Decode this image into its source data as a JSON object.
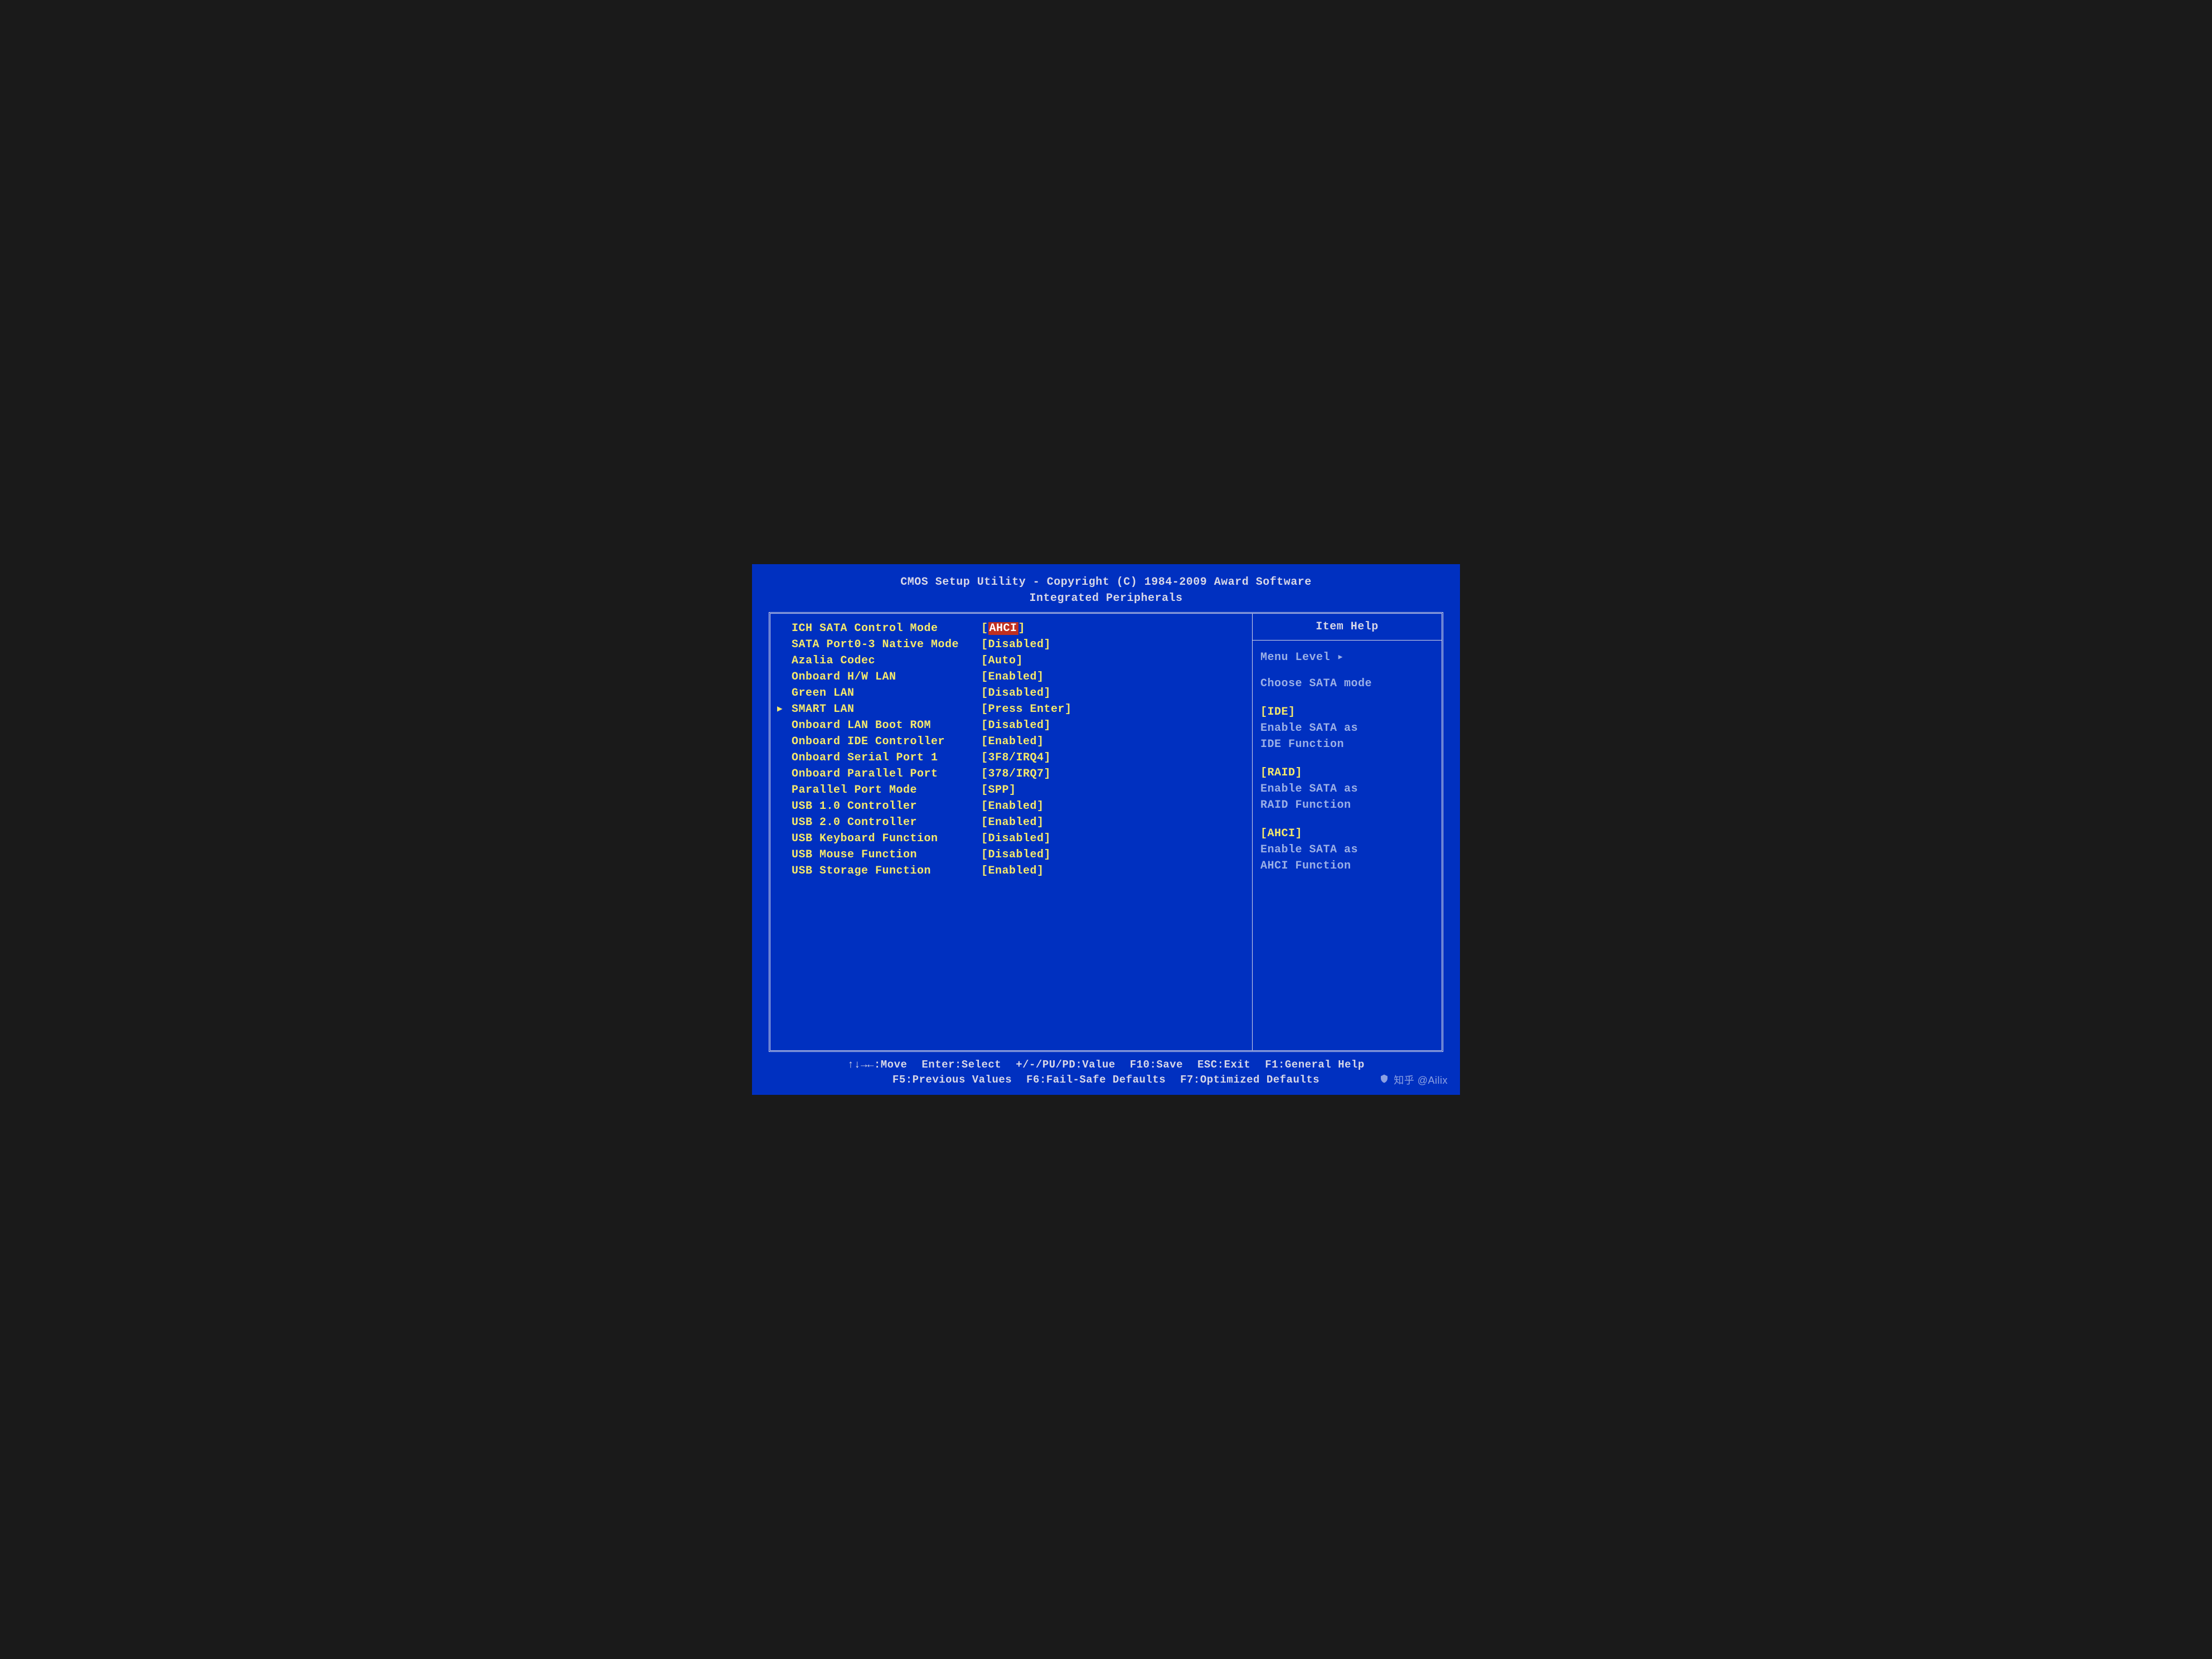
{
  "header": {
    "line1": "CMOS Setup Utility - Copyright (C) 1984-2009 Award Software",
    "line2": "Integrated Peripherals"
  },
  "settings": [
    {
      "label": "ICH SATA Control Mode",
      "value": "AHCI",
      "selected": true,
      "submenu": false
    },
    {
      "label": "SATA Port0-3 Native Mode",
      "value": "Disabled",
      "selected": false,
      "submenu": false
    },
    {
      "label": "Azalia Codec",
      "value": "Auto",
      "selected": false,
      "submenu": false
    },
    {
      "label": "Onboard H/W LAN",
      "value": "Enabled",
      "selected": false,
      "submenu": false
    },
    {
      "label": "Green LAN",
      "value": "Disabled",
      "selected": false,
      "submenu": false
    },
    {
      "label": "SMART LAN",
      "value": "Press Enter",
      "selected": false,
      "submenu": true
    },
    {
      "label": "Onboard LAN Boot ROM",
      "value": "Disabled",
      "selected": false,
      "submenu": false
    },
    {
      "label": "Onboard IDE Controller",
      "value": "Enabled",
      "selected": false,
      "submenu": false
    },
    {
      "label": "Onboard Serial Port 1",
      "value": "3F8/IRQ4",
      "selected": false,
      "submenu": false
    },
    {
      "label": "Onboard Parallel Port",
      "value": "378/IRQ7",
      "selected": false,
      "submenu": false
    },
    {
      "label": "Parallel Port Mode",
      "value": "SPP",
      "selected": false,
      "submenu": false
    },
    {
      "label": "USB 1.0 Controller",
      "value": "Enabled",
      "selected": false,
      "submenu": false
    },
    {
      "label": "USB 2.0 Controller",
      "value": "Enabled",
      "selected": false,
      "submenu": false
    },
    {
      "label": "USB Keyboard Function",
      "value": "Disabled",
      "selected": false,
      "submenu": false
    },
    {
      "label": "USB Mouse Function",
      "value": "Disabled",
      "selected": false,
      "submenu": false
    },
    {
      "label": "USB Storage Function",
      "value": "Enabled",
      "selected": false,
      "submenu": false
    }
  ],
  "help": {
    "title": "Item Help",
    "menu_level": "Menu Level   ▸",
    "context": "Choose SATA mode",
    "options": [
      {
        "head": "[IDE]",
        "desc1": "Enable SATA as",
        "desc2": "IDE Function"
      },
      {
        "head": "[RAID]",
        "desc1": "Enable SATA as",
        "desc2": "RAID Function"
      },
      {
        "head": "[AHCI]",
        "desc1": "Enable SATA as",
        "desc2": "AHCI Function"
      }
    ]
  },
  "footer": {
    "row1": [
      "↑↓→←:Move",
      "Enter:Select",
      "+/-/PU/PD:Value",
      "F10:Save",
      "ESC:Exit",
      "F1:General Help"
    ],
    "row2": [
      "F5:Previous Values",
      "F6:Fail-Safe Defaults",
      "F7:Optimized Defaults"
    ]
  },
  "watermark": "知乎 @Ailix"
}
